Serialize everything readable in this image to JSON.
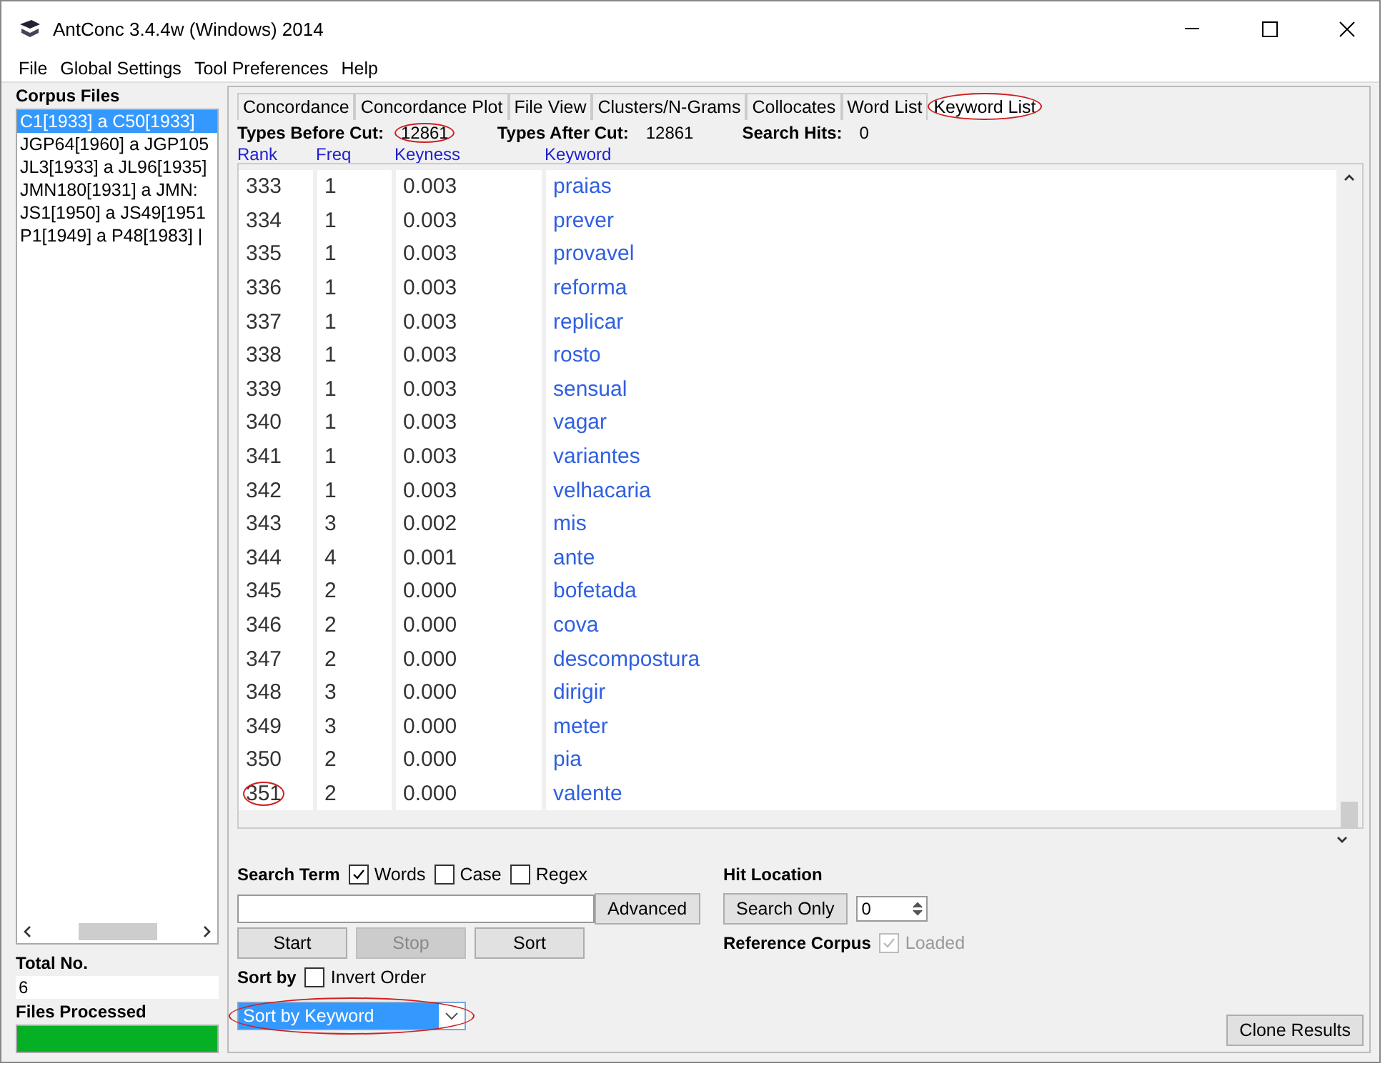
{
  "window": {
    "title": "AntConc 3.4.4w (Windows) 2014"
  },
  "menu": [
    "File",
    "Global Settings",
    "Tool Preferences",
    "Help"
  ],
  "corpus_files": {
    "title": "Corpus Files",
    "items": [
      {
        "label": "C1[1933] a C50[1933]",
        "selected": true
      },
      {
        "label": "JGP64[1960] a JGP105",
        "selected": false
      },
      {
        "label": "JL3[1933] a JL96[1935]",
        "selected": false
      },
      {
        "label": "JMN180[1931] a JMN:",
        "selected": false
      },
      {
        "label": "JS1[1950] a JS49[1951",
        "selected": false
      },
      {
        "label": "P1[1949] a P48[1983] |",
        "selected": false
      }
    ],
    "total_label": "Total No.",
    "total": "6",
    "processed": {
      "label": "Files Processed",
      "level": 1
    }
  },
  "tabs": [
    {
      "label": "Concordance",
      "selected": false,
      "circled": false
    },
    {
      "label": "Concordance Plot",
      "selected": false,
      "circled": false
    },
    {
      "label": "File View",
      "selected": false,
      "circled": false
    },
    {
      "label": "Clusters/N-Grams",
      "selected": false,
      "circled": false
    },
    {
      "label": "Collocates",
      "selected": false,
      "circled": false
    },
    {
      "label": "Word List",
      "selected": false,
      "circled": false
    },
    {
      "label": "Keyword List",
      "selected": true,
      "circled": true
    }
  ],
  "stats": [
    {
      "label": "Types Before Cut:",
      "value": "12861",
      "circled": true
    },
    {
      "label": "Types After Cut:",
      "value": "12861",
      "circled": false
    },
    {
      "label": "Search Hits:",
      "value": "0",
      "circled": false
    }
  ],
  "table": {
    "columns": [
      "Rank",
      "Freq",
      "Keyness",
      "Keyword"
    ],
    "rows": [
      {
        "rank": "333",
        "freq": "1",
        "keyness": "0.003",
        "keyword": "praias",
        "circled": false
      },
      {
        "rank": "334",
        "freq": "1",
        "keyness": "0.003",
        "keyword": "prever",
        "circled": false
      },
      {
        "rank": "335",
        "freq": "1",
        "keyness": "0.003",
        "keyword": "provavel",
        "circled": false
      },
      {
        "rank": "336",
        "freq": "1",
        "keyness": "0.003",
        "keyword": "reforma",
        "circled": false
      },
      {
        "rank": "337",
        "freq": "1",
        "keyness": "0.003",
        "keyword": "replicar",
        "circled": false
      },
      {
        "rank": "338",
        "freq": "1",
        "keyness": "0.003",
        "keyword": "rosto",
        "circled": false
      },
      {
        "rank": "339",
        "freq": "1",
        "keyness": "0.003",
        "keyword": "sensual",
        "circled": false
      },
      {
        "rank": "340",
        "freq": "1",
        "keyness": "0.003",
        "keyword": "vagar",
        "circled": false
      },
      {
        "rank": "341",
        "freq": "1",
        "keyness": "0.003",
        "keyword": "variantes",
        "circled": false
      },
      {
        "rank": "342",
        "freq": "1",
        "keyness": "0.003",
        "keyword": "velhacaria",
        "circled": false
      },
      {
        "rank": "343",
        "freq": "3",
        "keyness": "0.002",
        "keyword": "mis",
        "circled": false
      },
      {
        "rank": "344",
        "freq": "4",
        "keyness": "0.001",
        "keyword": "ante",
        "circled": false
      },
      {
        "rank": "345",
        "freq": "2",
        "keyness": "0.000",
        "keyword": "bofetada",
        "circled": false
      },
      {
        "rank": "346",
        "freq": "2",
        "keyness": "0.000",
        "keyword": "cova",
        "circled": false
      },
      {
        "rank": "347",
        "freq": "2",
        "keyness": "0.000",
        "keyword": "descompostura",
        "circled": false
      },
      {
        "rank": "348",
        "freq": "3",
        "keyness": "0.000",
        "keyword": "dirigir",
        "circled": false
      },
      {
        "rank": "349",
        "freq": "3",
        "keyness": "0.000",
        "keyword": "meter",
        "circled": false
      },
      {
        "rank": "350",
        "freq": "2",
        "keyness": "0.000",
        "keyword": "pia",
        "circled": false
      },
      {
        "rank": "351",
        "freq": "2",
        "keyness": "0.000",
        "keyword": "valente",
        "circled": true
      }
    ]
  },
  "search": {
    "label": "Search Term",
    "options": [
      {
        "label": "Words",
        "checked": true
      },
      {
        "label": "Case",
        "checked": false
      },
      {
        "label": "Regex",
        "checked": false
      }
    ],
    "advanced": "Advanced"
  },
  "buttons": [
    {
      "label": "Start",
      "disabled": false
    },
    {
      "label": "Stop",
      "disabled": true
    },
    {
      "label": "Sort",
      "disabled": false
    }
  ],
  "sort": {
    "label": "Sort by",
    "invert": {
      "label": "Invert Order",
      "checked": false
    },
    "value": "Sort by Keyword",
    "circled": true
  },
  "hit_location": {
    "label": "Hit Location",
    "button": "Search Only",
    "value": "0"
  },
  "reference": {
    "label": "Reference Corpus",
    "option": {
      "label": "Loaded",
      "checked": true,
      "disabled": true
    }
  },
  "clone": "Clone Results"
}
